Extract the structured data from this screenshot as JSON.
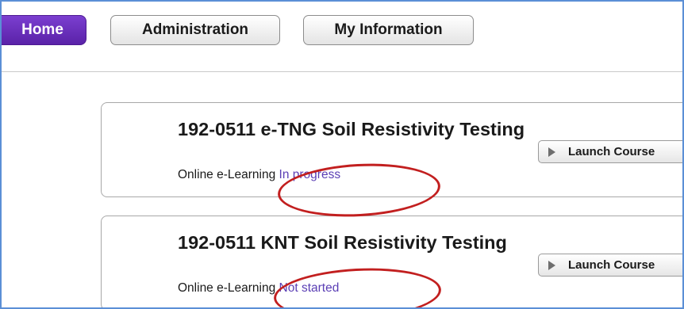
{
  "nav": {
    "tabs": [
      {
        "label": "Home",
        "active": true
      },
      {
        "label": "Administration",
        "active": false
      },
      {
        "label": "My Information",
        "active": false
      }
    ]
  },
  "courses": [
    {
      "title": "192-0511 e-TNG Soil Resistivity Testing",
      "type": "Online e-Learning",
      "status": "In progress",
      "launch_label": "Launch Course"
    },
    {
      "title": "192-0511 KNT Soil Resistivity Testing",
      "type": "Online e-Learning",
      "status": "Not started",
      "launch_label": "Launch Course"
    }
  ],
  "colors": {
    "accent": "#5a22a8",
    "status_link": "#5b3fb5",
    "annotation": "#c21f1f",
    "frame_border": "#5b8fd6"
  }
}
